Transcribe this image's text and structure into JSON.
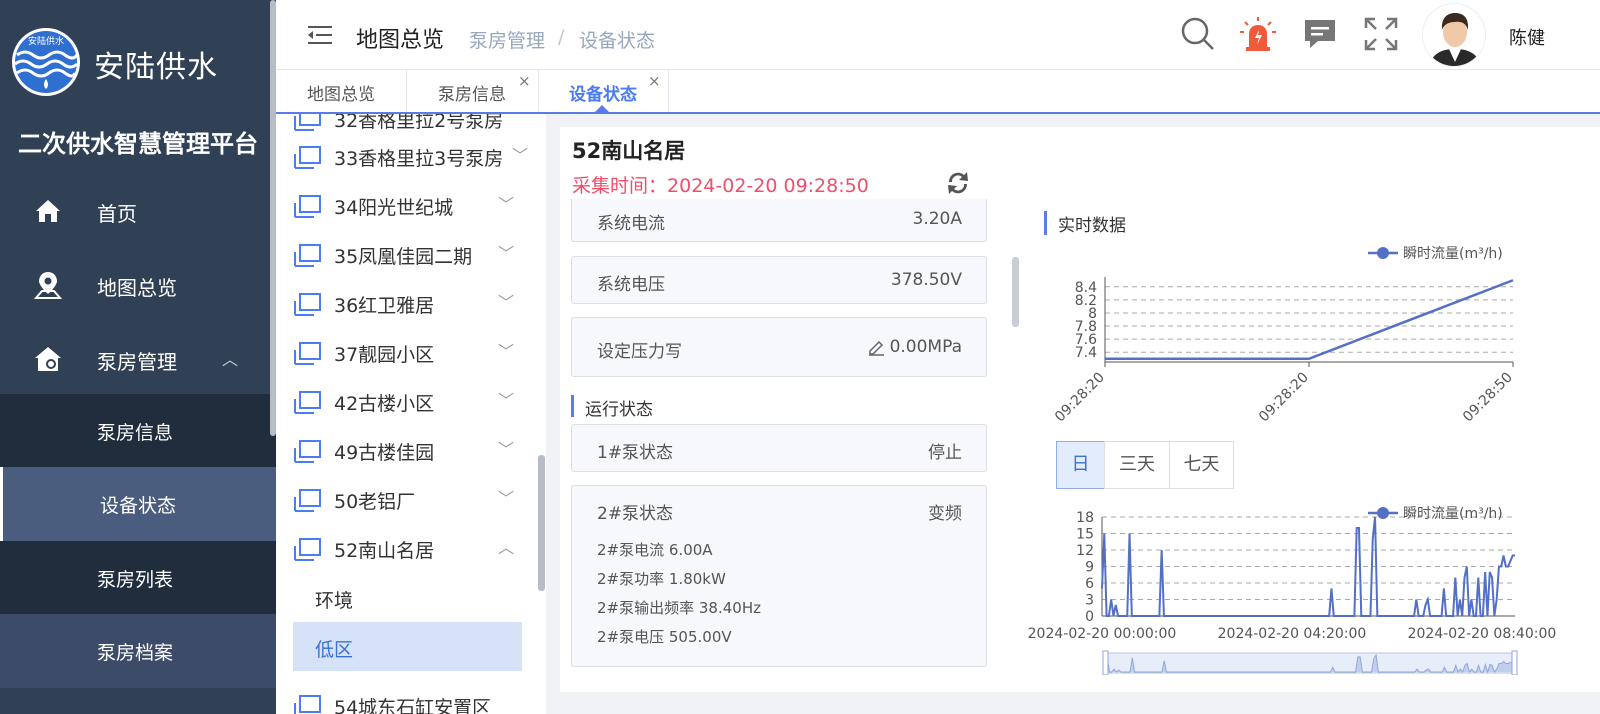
{
  "sidebar": {
    "brand": "安陆供水",
    "logo_text": "安陆供水",
    "platform": "二次供水智慧管理平台",
    "menu": [
      {
        "label": "首页",
        "icon": "home-icon"
      },
      {
        "label": "地图总览",
        "icon": "map-pin-icon"
      },
      {
        "label": "泵房管理",
        "icon": "pump-house-icon",
        "expanded": true
      }
    ],
    "submenu": [
      {
        "label": "泵房信息"
      },
      {
        "label": "设备状态",
        "active": true
      },
      {
        "label": "泵房列表"
      },
      {
        "label": "泵房档案"
      }
    ]
  },
  "header": {
    "title": "地图总览",
    "breadcrumb": [
      "泵房管理",
      "设备状态"
    ],
    "breadcrumb_separator": "/",
    "user": "陈健",
    "icons": [
      "search-icon",
      "alarm-icon",
      "message-icon",
      "fullscreen-icon"
    ]
  },
  "tabs": [
    {
      "label": "地图总览",
      "closable": false
    },
    {
      "label": "泵房信息",
      "closable": true
    },
    {
      "label": "设备状态",
      "closable": true,
      "active": true
    }
  ],
  "tab_close_glyph": "×",
  "tree": {
    "nodes": [
      {
        "label": "33香格里拉3号泵房",
        "expanded": false
      },
      {
        "label": "34阳光世纪城",
        "expanded": false
      },
      {
        "label": "35凤凰佳园二期",
        "expanded": false
      },
      {
        "label": "36红卫雅居",
        "expanded": false
      },
      {
        "label": "37靓园小区",
        "expanded": false
      },
      {
        "label": "42古楼小区",
        "expanded": false
      },
      {
        "label": "49古楼佳园",
        "expanded": false
      },
      {
        "label": "50老铝厂",
        "expanded": false
      },
      {
        "label": "52南山名居",
        "expanded": true
      }
    ],
    "children": [
      {
        "label": "环境",
        "selected": false
      },
      {
        "label": "低区",
        "selected": true
      }
    ],
    "partial_top": "32香格里拉2号泵房",
    "partial_bottom": "54城东石缸安置区"
  },
  "panel": {
    "station": "52南山名居",
    "collect_label": "采集时间：",
    "collect_time": "2024-02-20 09:28:50",
    "rows": [
      {
        "label": "系统电流",
        "value": "3.20A"
      },
      {
        "label": "系统电压",
        "value": "378.50V"
      },
      {
        "label": "设定压力写",
        "value": "0.00MPa",
        "editable": true
      }
    ],
    "run_title": "运行状态",
    "pump1": {
      "label": "1#泵状态",
      "value": "停止"
    },
    "pump2": {
      "label": "2#泵状态",
      "value": "变频",
      "details": [
        "2#泵电流 6.00A",
        "2#泵功率 1.80kW",
        "2#泵输出频率 38.40Hz",
        "2#泵电压 505.00V"
      ]
    }
  },
  "realtime": {
    "title": "实时数据",
    "range_buttons": [
      "日",
      "三天",
      "七天"
    ],
    "active_range": "日"
  },
  "colors": {
    "sidebar": "#304156",
    "accent": "#5b7be8",
    "time": "#ef4f6a",
    "line": "#5470c6"
  },
  "chart_data": [
    {
      "type": "line",
      "legend": "瞬时流量(m³/h)",
      "x": [
        "09:28:20",
        "09:28:20",
        "09:28:50"
      ],
      "xticks": [
        "09:28:20",
        "09:28:20",
        "09:28:50"
      ],
      "y": [
        7.3,
        7.3,
        8.5
      ],
      "yticks": [
        7.4,
        7.6,
        7.8,
        8,
        8.2,
        8.4
      ],
      "ylim": [
        7.25,
        8.55
      ]
    },
    {
      "type": "line",
      "legend": "瞬时流量(m³/h)",
      "xticks": [
        "2024-02-20 00:00:00",
        "2024-02-20 04:20:00",
        "2024-02-20 08:40:00"
      ],
      "yticks": [
        0,
        3,
        6,
        9,
        12,
        15,
        18
      ],
      "ylim": [
        0,
        18
      ],
      "values": [
        5,
        15,
        0,
        0,
        3,
        0,
        2,
        0,
        0,
        0,
        0,
        0,
        15,
        0,
        0,
        0,
        0,
        0,
        0,
        0,
        0,
        0,
        0,
        0,
        0,
        0,
        12,
        0,
        0,
        0,
        0,
        0,
        0,
        0,
        0,
        0,
        0,
        0,
        0,
        0,
        0,
        0,
        0,
        0,
        0,
        0,
        0,
        0,
        0,
        0,
        0,
        0,
        0,
        0,
        0,
        0,
        0,
        0,
        0,
        0,
        0,
        0,
        0,
        0,
        0,
        0,
        0,
        0,
        0,
        0,
        0,
        0,
        0,
        0,
        0,
        0,
        0,
        0,
        0,
        0,
        0,
        0,
        0,
        0,
        0,
        0,
        0,
        0,
        0,
        0,
        0,
        0,
        0,
        0,
        0,
        0,
        0,
        0,
        0,
        0,
        5,
        0,
        0,
        0,
        0,
        0,
        0,
        0,
        0,
        0,
        0,
        16,
        16,
        0,
        0,
        0,
        0,
        0,
        14,
        18,
        0,
        0,
        0,
        0,
        0,
        0,
        0,
        0,
        0,
        0,
        0,
        0,
        0,
        0,
        0,
        0,
        0,
        3,
        0,
        0,
        0,
        2,
        3,
        0,
        0,
        0,
        0,
        0,
        0,
        5,
        0,
        0,
        0,
        0,
        7,
        0,
        3,
        0,
        7,
        9,
        0,
        3,
        0,
        0,
        7,
        0,
        0,
        8,
        0,
        8,
        7,
        0,
        3,
        9,
        9,
        11,
        9,
        9,
        10,
        11,
        11
      ]
    }
  ]
}
